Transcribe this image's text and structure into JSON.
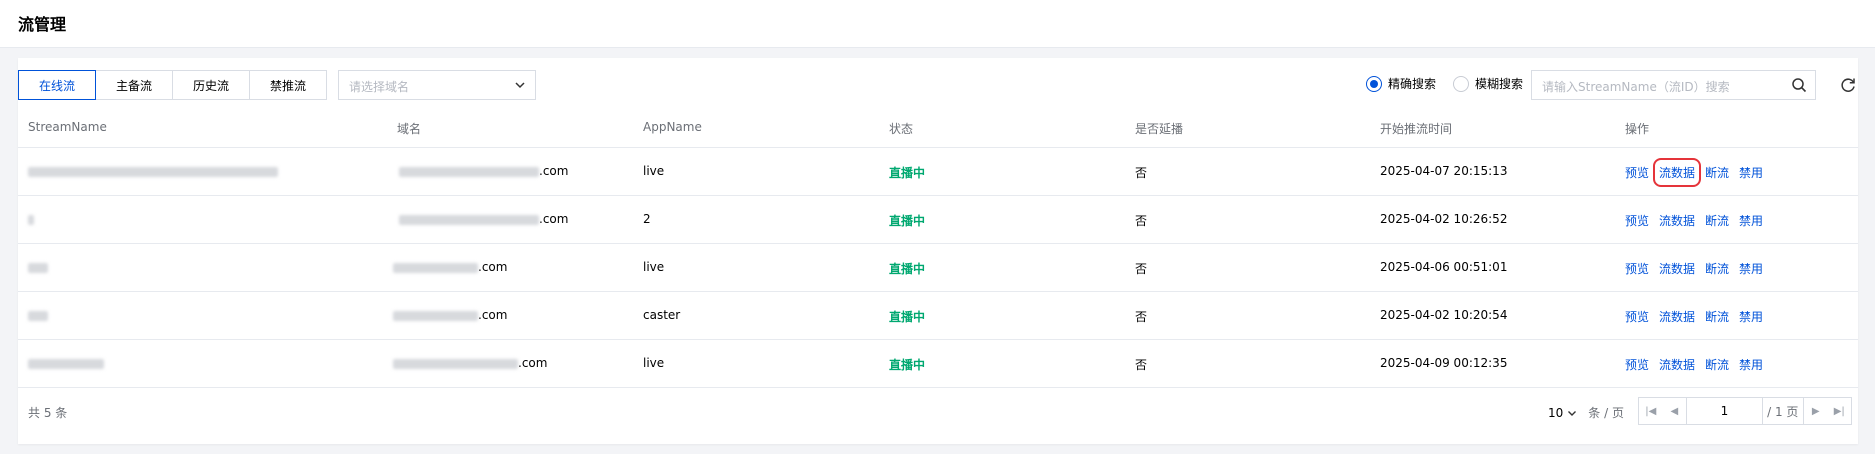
{
  "header": {
    "title": "流管理"
  },
  "tabs": [
    {
      "label": "在线流",
      "active": true
    },
    {
      "label": "主备流",
      "active": false
    },
    {
      "label": "历史流",
      "active": false
    },
    {
      "label": "禁推流",
      "active": false
    }
  ],
  "domain_select": {
    "placeholder": "请选择域名",
    "icon": "chevron-down-icon"
  },
  "search_mode": {
    "exact": {
      "label": "精确搜索",
      "selected": true
    },
    "fuzzy": {
      "label": "模糊搜索",
      "selected": false
    }
  },
  "search": {
    "placeholder": "请输入StreamName（流ID）搜索",
    "icon": "search-icon"
  },
  "refresh": {
    "icon": "refresh-icon"
  },
  "table": {
    "columns": [
      "StreamName",
      "域名",
      "AppName",
      "状态",
      "是否延播",
      "开始推流时间",
      "操作"
    ],
    "rows": [
      {
        "domain_suffix": ".com",
        "app": "live",
        "status": "直播中",
        "delay": "否",
        "start_time": "2025-04-07 20:15:13"
      },
      {
        "domain_suffix": ".com",
        "app": "2",
        "status": "直播中",
        "delay": "否",
        "start_time": "2025-04-02 10:26:52"
      },
      {
        "domain_suffix": ".com",
        "app": "live",
        "status": "直播中",
        "delay": "否",
        "start_time": "2025-04-06 00:51:01"
      },
      {
        "domain_suffix": ".com",
        "app": "caster",
        "status": "直播中",
        "delay": "否",
        "start_time": "2025-04-02 10:20:54"
      },
      {
        "domain_suffix": ".com",
        "app": "live",
        "status": "直播中",
        "delay": "否",
        "start_time": "2025-04-09 00:12:35"
      }
    ],
    "actions": [
      "预览",
      "流数据",
      "断流",
      "禁用"
    ]
  },
  "footer": {
    "total": "共 5 条",
    "page_size": "10",
    "page_size_unit": "条 / 页",
    "current_page": "1",
    "total_pages": "/ 1 页"
  },
  "colors": {
    "primary": "#0052d9",
    "live_status": "#00a870",
    "highlight": "#e5343a"
  }
}
